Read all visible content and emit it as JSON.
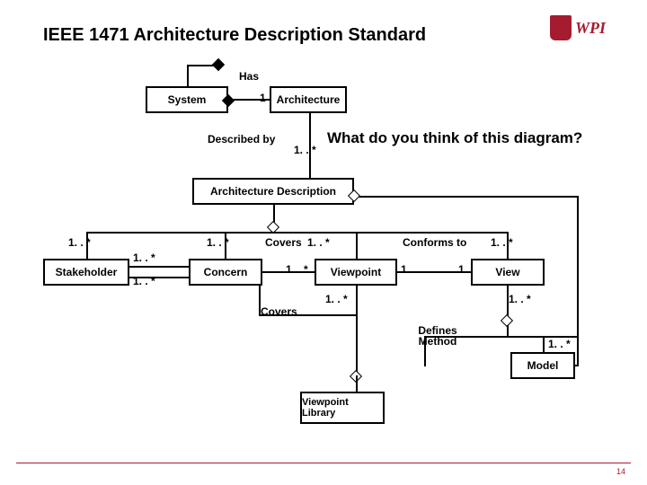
{
  "title": "IEEE 1471 Architecture Description Standard",
  "logo_text": "WPI",
  "question": "What do you think of this diagram?",
  "page_number": "14",
  "boxes": {
    "system": "System",
    "architecture": "Architecture",
    "arch_desc": "Architecture Description",
    "stakeholder": "Stakeholder",
    "concern": "Concern",
    "viewpoint": "Viewpoint",
    "view": "View",
    "model": "Model",
    "vp_library": "Viewpoint Library"
  },
  "labels": {
    "has": "Has",
    "described_by": "Described by",
    "covers": "Covers",
    "covers2": "Covers",
    "conforms_to": "Conforms to",
    "defines_method": "Defines Method"
  },
  "mult": {
    "arch_one": "1",
    "ad_one_star": "1. . *",
    "sh_left": "1. . *",
    "sh_top": "1. . *",
    "sh_bot": "1. . *",
    "concern_top": "1. . *",
    "covers_r": "1. . *",
    "vp_left": "1. . *",
    "vp_one": "1",
    "view_left": "1",
    "view_right": "1. . *",
    "vp_down": "1. . *",
    "view_down": "1. . *",
    "model_r": "1. . *"
  }
}
